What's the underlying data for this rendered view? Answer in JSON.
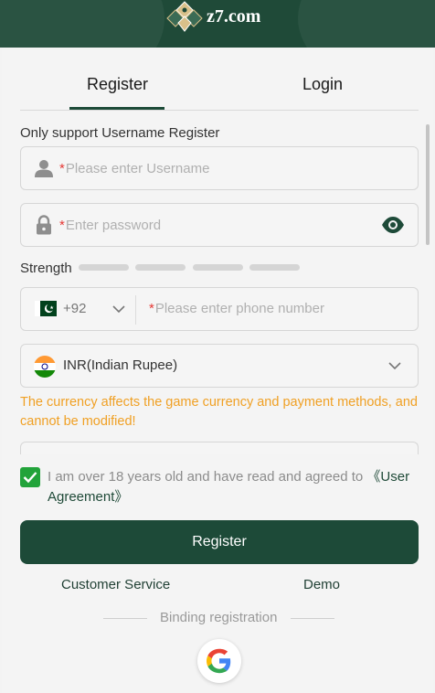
{
  "header": {
    "logo_text": "z7.com",
    "logo_icon": "crossed-diamonds-emblem-icon"
  },
  "tabs": [
    {
      "label": "Register",
      "active": true
    },
    {
      "label": "Login",
      "active": false
    }
  ],
  "form": {
    "hint": "Only support Username Register",
    "required_mark": "*",
    "username": {
      "placeholder": "Please enter Username",
      "value": "",
      "icon": "user-icon"
    },
    "password": {
      "placeholder": "Enter password",
      "value": "",
      "icon": "lock-icon",
      "toggle_icon": "eye-icon"
    },
    "strength": {
      "label": "Strength",
      "bars": 4,
      "level": 0
    },
    "phone": {
      "country_flag": "pakistan-flag-icon",
      "country_code": "+92",
      "placeholder": "Please enter phone number",
      "value": ""
    },
    "currency": {
      "flag": "india-flag-icon",
      "selected": "INR(Indian Rupee)"
    },
    "currency_warning": "The currency affects the game currency and payment methods, and cannot be modified!",
    "agreement": {
      "checked": true,
      "text": "I am over 18 years old and have read and agreed to ",
      "link_text": "《User Agreement》"
    },
    "submit_label": "Register"
  },
  "footer": {
    "customer_service": "Customer Service",
    "demo": "Demo",
    "binding_label": "Binding registration",
    "google_icon": "google-icon"
  },
  "colors": {
    "brand_green": "#1d4a38",
    "checkbox_green": "#22a33a",
    "warning_orange": "#f0a024",
    "required_red": "#e53935"
  }
}
